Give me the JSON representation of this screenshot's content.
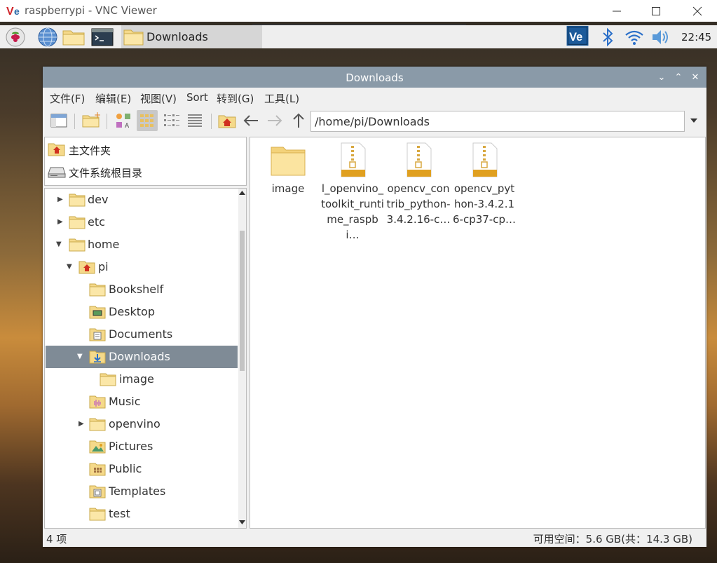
{
  "vnc": {
    "title": "raspberrypi - VNC Viewer"
  },
  "taskbar": {
    "active_window": "Downloads",
    "clock": "22:45"
  },
  "window": {
    "title": "Downloads"
  },
  "menu": [
    "文件(F)",
    "编辑(E)",
    "视图(V)",
    "Sort",
    "转到(G)",
    "工具(L)"
  ],
  "toolbar": {
    "path": "/home/pi/Downloads"
  },
  "places": [
    {
      "label": "主文件夹",
      "icon": "home-folder-icon"
    },
    {
      "label": "文件系统根目录",
      "icon": "drive-icon"
    }
  ],
  "tree": [
    {
      "label": "dev",
      "expander": "collapsed",
      "icon": "folder-icon"
    },
    {
      "label": "etc",
      "expander": "collapsed",
      "icon": "folder-icon"
    },
    {
      "label": "home",
      "expander": "expanded",
      "icon": "folder-icon"
    },
    {
      "label": "pi",
      "expander": "expanded",
      "icon": "home-folder-icon"
    },
    {
      "label": "Bookshelf",
      "expander": "none",
      "icon": "folder-icon"
    },
    {
      "label": "Desktop",
      "expander": "none",
      "icon": "desktop-folder-icon"
    },
    {
      "label": "Documents",
      "expander": "none",
      "icon": "documents-folder-icon"
    },
    {
      "label": "Downloads",
      "expander": "expanded",
      "icon": "downloads-folder-icon",
      "selected": true
    },
    {
      "label": "image",
      "expander": "none",
      "icon": "folder-icon"
    },
    {
      "label": "Music",
      "expander": "none",
      "icon": "music-folder-icon"
    },
    {
      "label": "openvino",
      "expander": "collapsed",
      "icon": "folder-icon"
    },
    {
      "label": "Pictures",
      "expander": "none",
      "icon": "pictures-folder-icon"
    },
    {
      "label": "Public",
      "expander": "none",
      "icon": "public-folder-icon"
    },
    {
      "label": "Templates",
      "expander": "none",
      "icon": "templates-folder-icon"
    },
    {
      "label": "test",
      "expander": "none",
      "icon": "folder-icon"
    }
  ],
  "files": [
    {
      "name": "image",
      "type": "folder"
    },
    {
      "name": "l_openvino_toolkit_runtime_raspbi…",
      "type": "archive"
    },
    {
      "name": "opencv_contrib_python-3.4.2.16-c…",
      "type": "archive"
    },
    {
      "name": "opencv_python-3.4.2.16-cp37-cp…",
      "type": "archive"
    }
  ],
  "status": {
    "count": "4 项",
    "free_space": "可用空间：5.6 GB(共：14.3 GB)"
  }
}
